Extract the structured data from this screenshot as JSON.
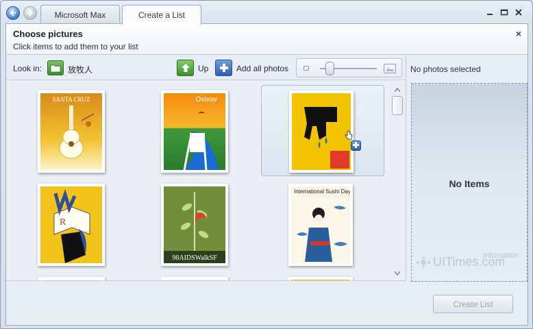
{
  "window": {
    "tabs": [
      {
        "label": "Microsoft Max",
        "active": false
      },
      {
        "label": "Create a List",
        "active": true
      }
    ],
    "controls": [
      "minimize-icon",
      "maximize-icon",
      "close-icon"
    ]
  },
  "header": {
    "title": "Choose pictures",
    "subtitle": "Click items to add them to your list",
    "close_glyph": "×"
  },
  "toolbar": {
    "look_in_label": "Look in:",
    "folder_name": "放牧人",
    "up_label": "Up",
    "add_all_label": "Add all photos",
    "zoom_level": 0.1
  },
  "pictures": [
    {
      "id": "santa-cruz",
      "caption_text": "SANTA CRUZ",
      "selected": false
    },
    {
      "id": "oxbow",
      "caption_text": "Oxbow",
      "selected": false
    },
    {
      "id": "gun-poster",
      "caption_text": "",
      "selected": true
    },
    {
      "id": "hand-book",
      "caption_text": "",
      "selected": false
    },
    {
      "id": "aids-walk",
      "caption_text": "98AIDSWalkSF",
      "selected": false
    },
    {
      "id": "sushi-day",
      "caption_text": "International Sushi Day",
      "selected": false
    }
  ],
  "selection": {
    "status": "No photos selected",
    "empty_label": "No Items"
  },
  "watermark": {
    "text": "UITimes.com",
    "small": "infomation"
  },
  "footer": {
    "create_label": "Create List",
    "create_enabled": false
  },
  "colors": {
    "accent_blue": "#2f5fb1",
    "accent_green": "#379128",
    "poster_yellow": "#f5c400"
  }
}
